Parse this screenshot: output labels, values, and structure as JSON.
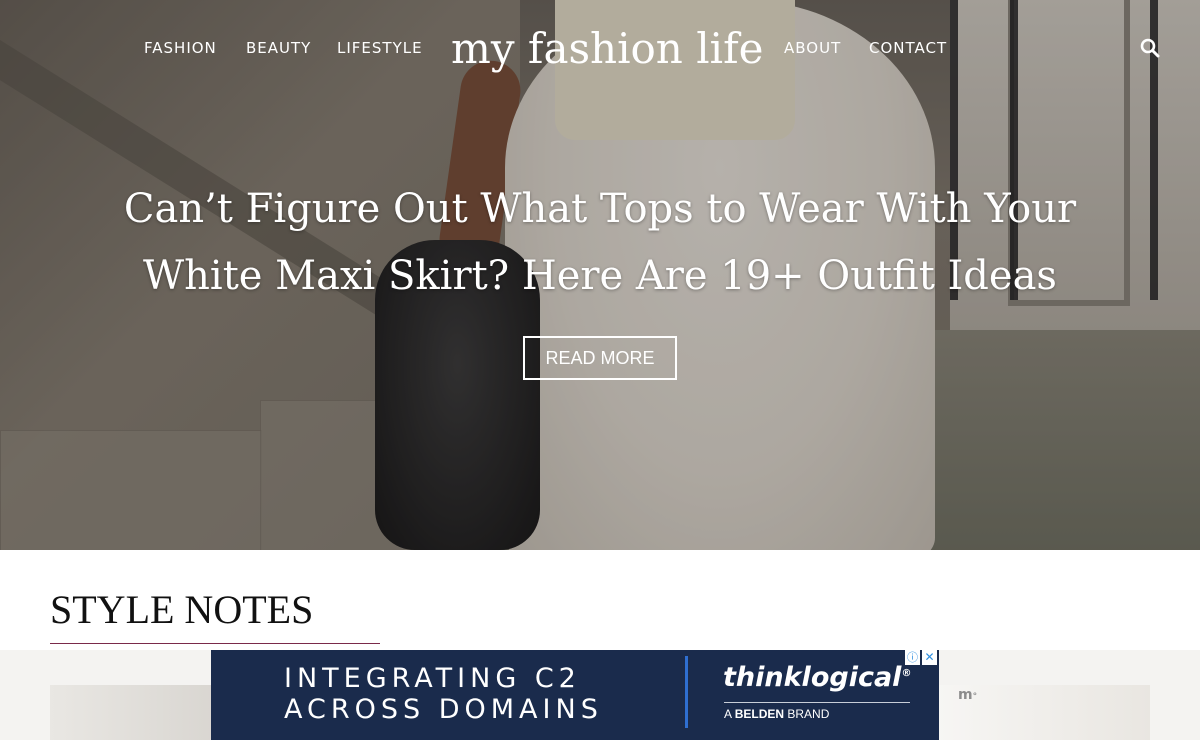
{
  "header": {
    "nav_left": [
      {
        "label": "FASHION"
      },
      {
        "label": "BEAUTY"
      },
      {
        "label": "LIFESTYLE"
      }
    ],
    "logo": "my fashion life",
    "nav_right": [
      {
        "label": "ABOUT"
      },
      {
        "label": "CONTACT"
      }
    ],
    "search_icon": "search-icon"
  },
  "hero": {
    "title_line1": "Can’t Figure Out What Tops to Wear With Your",
    "title_line2": "White Maxi Skirt? Here Are 19+ Outfit Ideas",
    "button_label": "READ MORE"
  },
  "section": {
    "title": "STYLE NOTES",
    "accent_color": "#7a2a4a"
  },
  "ad": {
    "line1": "INTEGRATING C2",
    "line2": "ACROSS DOMAINS",
    "brand": "thinklogical",
    "brand_mark": "®",
    "sub_prefix": "A",
    "sub_brand": "BELDEN",
    "sub_suffix": "BRAND",
    "info_icon": "ⓘ",
    "close_icon": "✕",
    "background_color": "#1a2b4c",
    "divider_color": "#2f6fd1"
  },
  "tray_badge": "m"
}
